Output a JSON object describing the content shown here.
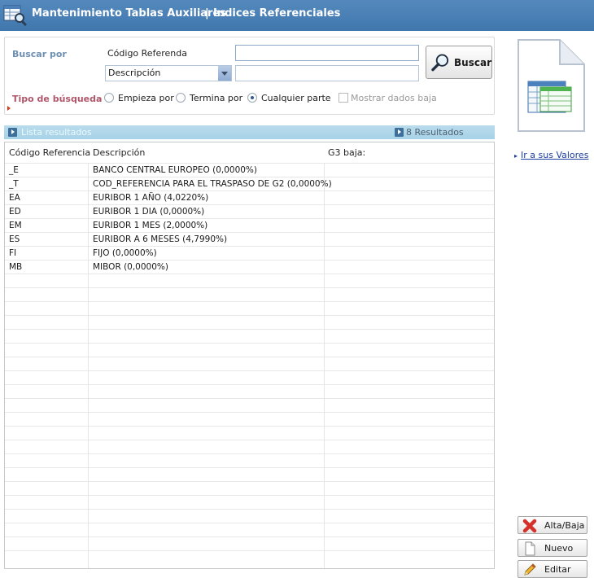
{
  "titlebar": {
    "app_title": "Mantenimiento Tablas Auxiliares",
    "separator": "|",
    "section_title": "Indices Referenciales"
  },
  "search": {
    "buscar_por_label": "Buscar por",
    "codigo_label": "Código Referenda",
    "codigo_value": "",
    "field_select_value": "Descripción",
    "field_value": "",
    "button_label": "Buscar",
    "tipo_label": "Tipo de búsqueda",
    "options": [
      "Empieza por",
      "Termina por",
      "Cualquier parte"
    ],
    "selected_option": "Cualquier parte",
    "show_deleted_label": "Mostrar dados baja",
    "show_deleted_checked": false
  },
  "results": {
    "list_label": "Lista resultados",
    "count_label": "8 Resultados",
    "columns": [
      "Código Referencia",
      "Descripción",
      "G3 baja:"
    ],
    "rows": [
      {
        "code": "_E",
        "desc": "BANCO CENTRAL EUROPEO (0,0000%)",
        "baja": ""
      },
      {
        "code": "_T",
        "desc": "COD_REFERENCIA PARA EL TRASPASO DE G2 (0,0000%)",
        "baja": ""
      },
      {
        "code": "EA",
        "desc": "EURIBOR 1 AÑO (4,0220%)",
        "baja": ""
      },
      {
        "code": "ED",
        "desc": "EURIBOR 1 DIA (0,0000%)",
        "baja": ""
      },
      {
        "code": "EM",
        "desc": "EURIBOR 1 MES (2,0000%)",
        "baja": ""
      },
      {
        "code": "ES",
        "desc": "EURIBOR A 6 MESES (4,7990%)",
        "baja": ""
      },
      {
        "code": "FI",
        "desc": "FIJO (0,0000%)",
        "baja": ""
      },
      {
        "code": "MB",
        "desc": "MIBOR (0,0000%)",
        "baja": ""
      }
    ]
  },
  "side": {
    "link_label": "Ir a sus Valores",
    "alta_baja_label": "Alta/Baja",
    "nuevo_label": "Nuevo",
    "editar_label": "Editar"
  },
  "icons": {
    "app": "table-search-icon",
    "search": "magnifier-icon",
    "document": "document-table-icon",
    "alta_baja": "red-x-icon",
    "nuevo": "blank-page-icon",
    "editar": "pencil-icon"
  },
  "colors": {
    "titlebar": "#4a80b5",
    "label_blue": "#6f8fb2",
    "results_bar": "#add5e9",
    "link": "#1b3fa0",
    "delete_red": "#d6302a"
  }
}
